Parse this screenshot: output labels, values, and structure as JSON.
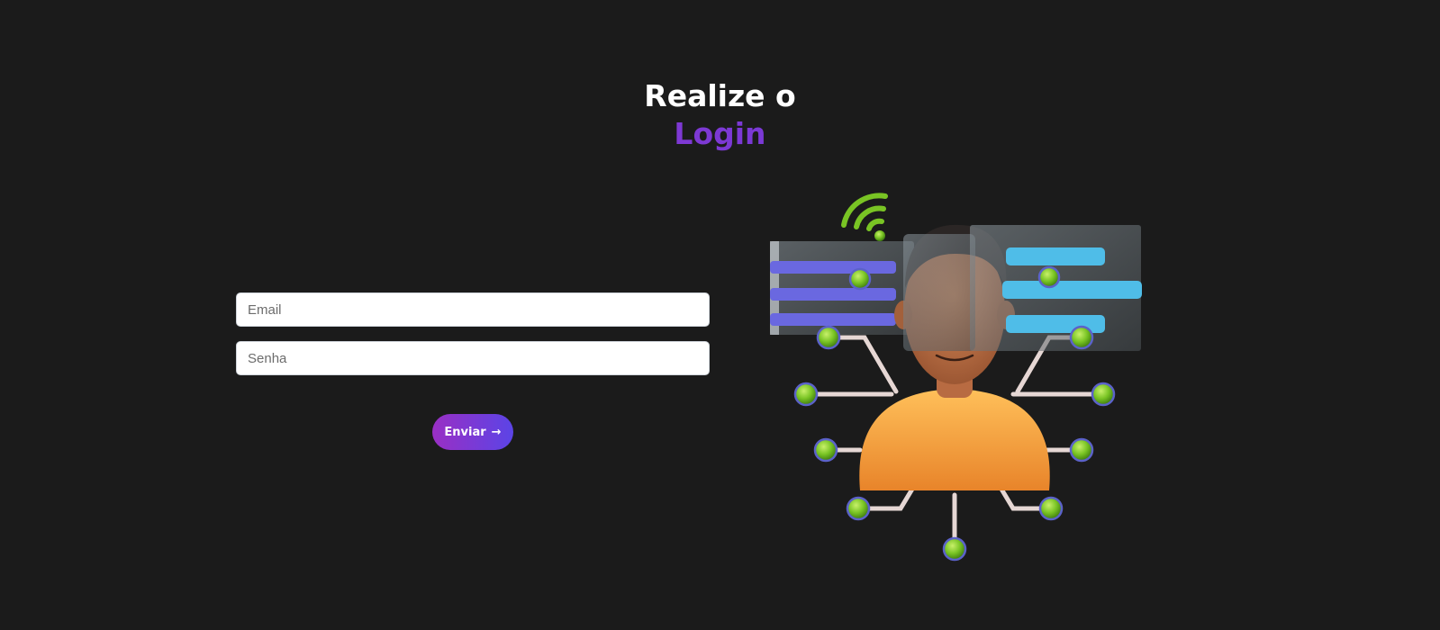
{
  "heading": {
    "line1": "Realize o",
    "line2": "Login"
  },
  "form": {
    "email_placeholder": "Email",
    "password_placeholder": "Senha",
    "submit_label": "Enviar",
    "submit_icon": "→"
  },
  "illustration": {
    "subject": "3d-avatar-network",
    "icon": "wifi-icon"
  },
  "colors": {
    "background": "#1b1b1b",
    "accent_start": "#9a2fc4",
    "accent_end": "#5b44e6",
    "node_green": "#79c424",
    "panel_purple": "#6a68e0",
    "panel_blue": "#4fbde8",
    "shirt_orange": "#f5a03a"
  }
}
